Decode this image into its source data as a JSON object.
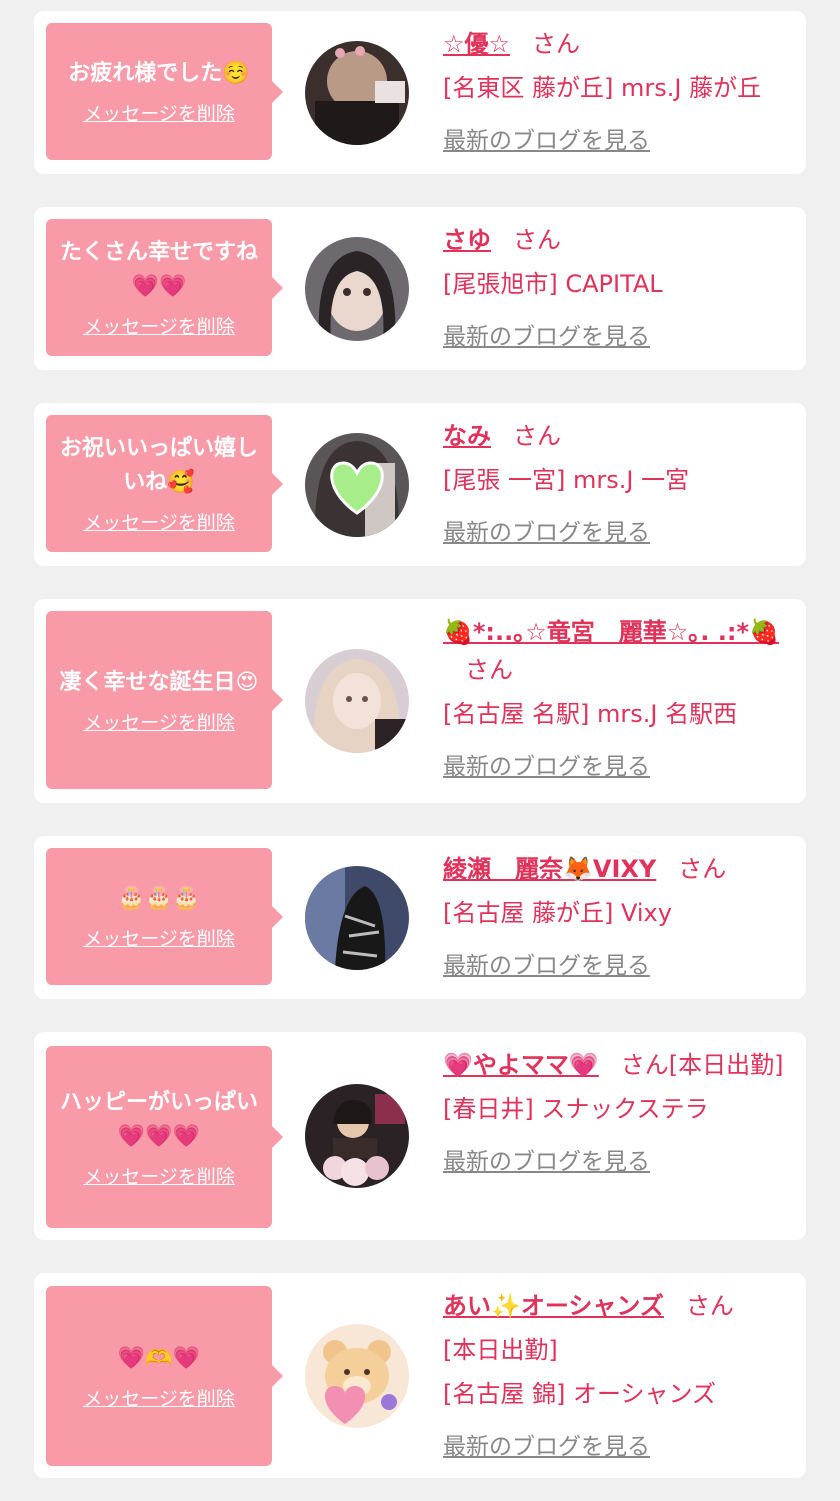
{
  "colors": {
    "accent": "#e0325a",
    "bubble": "#f99aa8",
    "link_gray": "#888888",
    "background": "#f0f0f0"
  },
  "delete_label": "メッセージを削除",
  "blog_label": "最新のブログを見る",
  "san_label": "さん",
  "entries": [
    {
      "message": "お疲れ様でした☺️",
      "name": "☆優☆",
      "suffix": "さん",
      "detail": "",
      "shop": "[名東区 藤が丘] mrs.J 藤が丘",
      "avatar": "avatar-photo"
    },
    {
      "message": "たくさん幸せですね💗💗",
      "name": "さゆ",
      "suffix": "さん",
      "detail": "",
      "shop": "[尾張旭市] CAPITAL",
      "avatar": "avatar-photo"
    },
    {
      "message": "お祝いいっぱい嬉しいね🥰",
      "name": "なみ",
      "suffix": "さん",
      "detail": "",
      "shop": "[尾張 一宮] mrs.J 一宮",
      "avatar": "avatar-photo-heart-sticker"
    },
    {
      "message": "凄く幸せな誕生日😍",
      "name": "🍓*:..｡☆竜宮　麗華☆｡. .:*🍓",
      "suffix": "さん",
      "detail": "",
      "shop": "[名古屋 名駅] mrs.J 名駅西",
      "avatar": "avatar-photo"
    },
    {
      "message": "🎂🎂🎂",
      "name": "綾瀬　麗奈🦊VIXY",
      "suffix": "さん",
      "detail": "",
      "shop": "[名古屋 藤が丘] Vixy",
      "avatar": "avatar-photo"
    },
    {
      "message": "ハッピーがいっぱい💗💗💗",
      "name": "💗やよママ💗",
      "suffix": "さん[本日出勤]",
      "detail": "",
      "shop": "[春日井] スナックステラ",
      "avatar": "avatar-photo"
    },
    {
      "message": "💗🫶💗",
      "name": "あい✨オーシャンズ",
      "suffix": "さん",
      "detail": "[本日出勤]",
      "shop": "[名古屋 錦] オーシャンズ",
      "avatar": "avatar-bear-illustration"
    }
  ]
}
